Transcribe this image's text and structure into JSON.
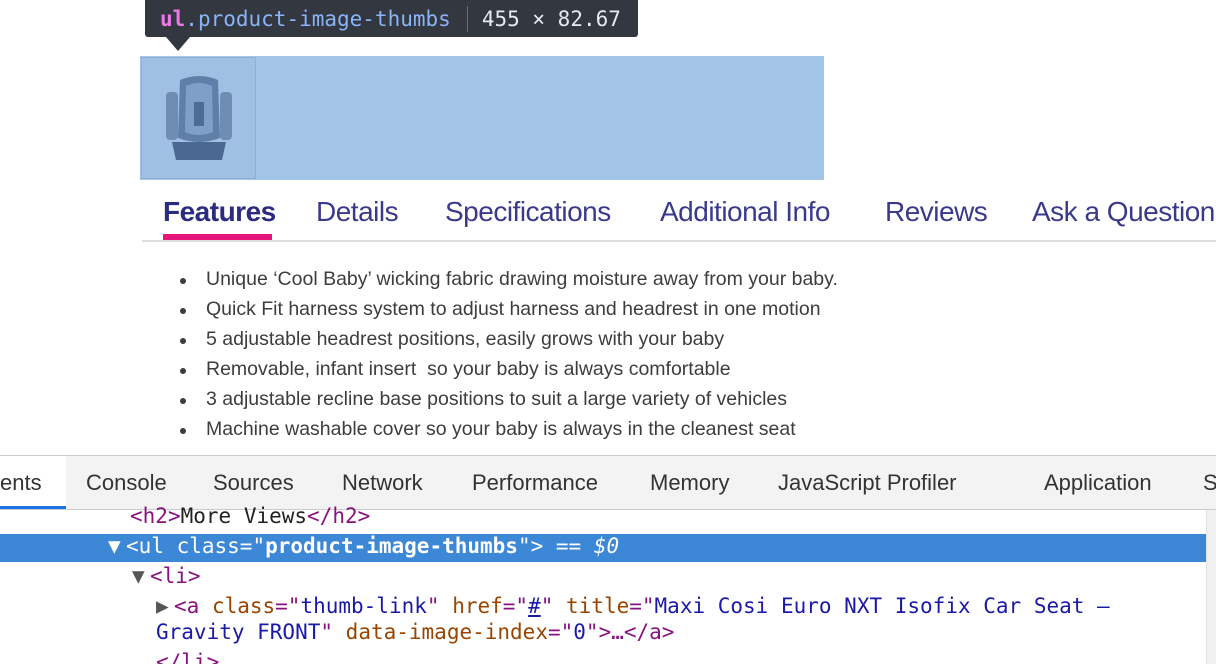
{
  "inspector_tooltip": {
    "tag": "ul",
    "class_name": ".product-image-thumbs",
    "dimensions": "455 × 82.67"
  },
  "tabs": [
    {
      "label": "Features",
      "active": true
    },
    {
      "label": "Details"
    },
    {
      "label": "Specifications"
    },
    {
      "label": "Additional Info"
    },
    {
      "label": "Reviews"
    },
    {
      "label": "Ask a Question"
    }
  ],
  "features": [
    "Unique ‘Cool Baby’ wicking fabric drawing moisture away from your baby.",
    "Quick Fit harness system to adjust harness and headrest in one motion",
    "5 adjustable headrest positions, easily grows with your baby",
    "Removable, infant insert  so your baby is always comfortable",
    "3 adjustable recline base positions to suit a large variety of vehicles",
    "Machine washable cover so your baby is always in the cleanest seat"
  ],
  "devtools": {
    "tabs": [
      "ents",
      "Console",
      "Sources",
      "Network",
      "Performance",
      "Memory",
      "JavaScript Profiler",
      "Application",
      "S"
    ],
    "dom": {
      "line1": {
        "open": "<",
        "tag": "h2",
        "close": ">",
        "text": "More Views",
        "end": "</h2>"
      },
      "line2": {
        "triangle": "▼",
        "tag_open": "<ul ",
        "attr": "class",
        "eq": "=\"",
        "val": "product-image-thumbs",
        "end": "\">",
        "marker": " == $0"
      },
      "line3": {
        "triangle": "▼",
        "tag": "<li>"
      },
      "line4": {
        "triangle": "▶",
        "tag_open": "<a ",
        "attr1": "class",
        "val1": "thumb-link",
        "attr2": "href",
        "val2": "#",
        "attr3": "title",
        "val3": "Maxi Cosi Euro NXT Isofix Car Seat –"
      },
      "line5": {
        "val3_cont": "Gravity FRONT",
        "attr4": "data-image-index",
        "val4": "0",
        "tail": ">…</a>"
      },
      "line6": {
        "tag": "</li>"
      }
    }
  },
  "colors": {
    "highlight": "#a3c5e8",
    "tab_text": "#3a3a8c",
    "tab_underline": "#e5157a",
    "selected_row": "#3d87d7"
  }
}
